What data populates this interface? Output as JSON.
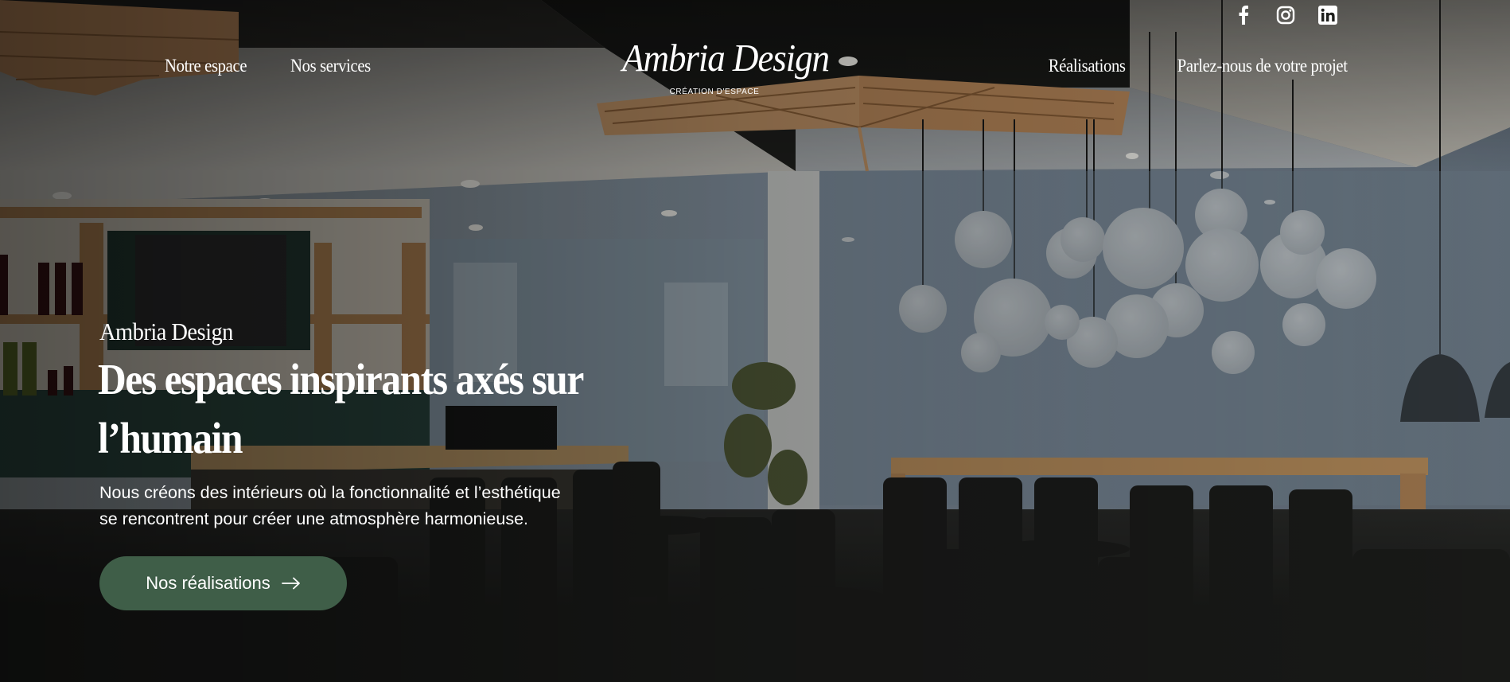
{
  "social": {
    "icons": [
      "facebook-icon",
      "instagram-icon",
      "linkedin-icon"
    ]
  },
  "nav": {
    "left": [
      "Notre espace",
      "Nos services"
    ],
    "right": [
      "Réalisations",
      "Parlez-nous de votre projet"
    ]
  },
  "logo": {
    "name": "Ambria Design",
    "tagline": "CRÉATION D'ESPACE"
  },
  "hero": {
    "eyebrow": "Ambria Design",
    "headline": [
      "Des espaces inspirants axés sur",
      "l’humain"
    ],
    "lead": [
      "Nous créons des intérieurs où la fonctionnalité et l’esthétique",
      "se rencontrent pour créer une atmosphère harmonieuse."
    ],
    "cta_label": "Nos réalisations",
    "cta_icon": "arrow-right-icon",
    "cta_color": "#3f5e48"
  }
}
